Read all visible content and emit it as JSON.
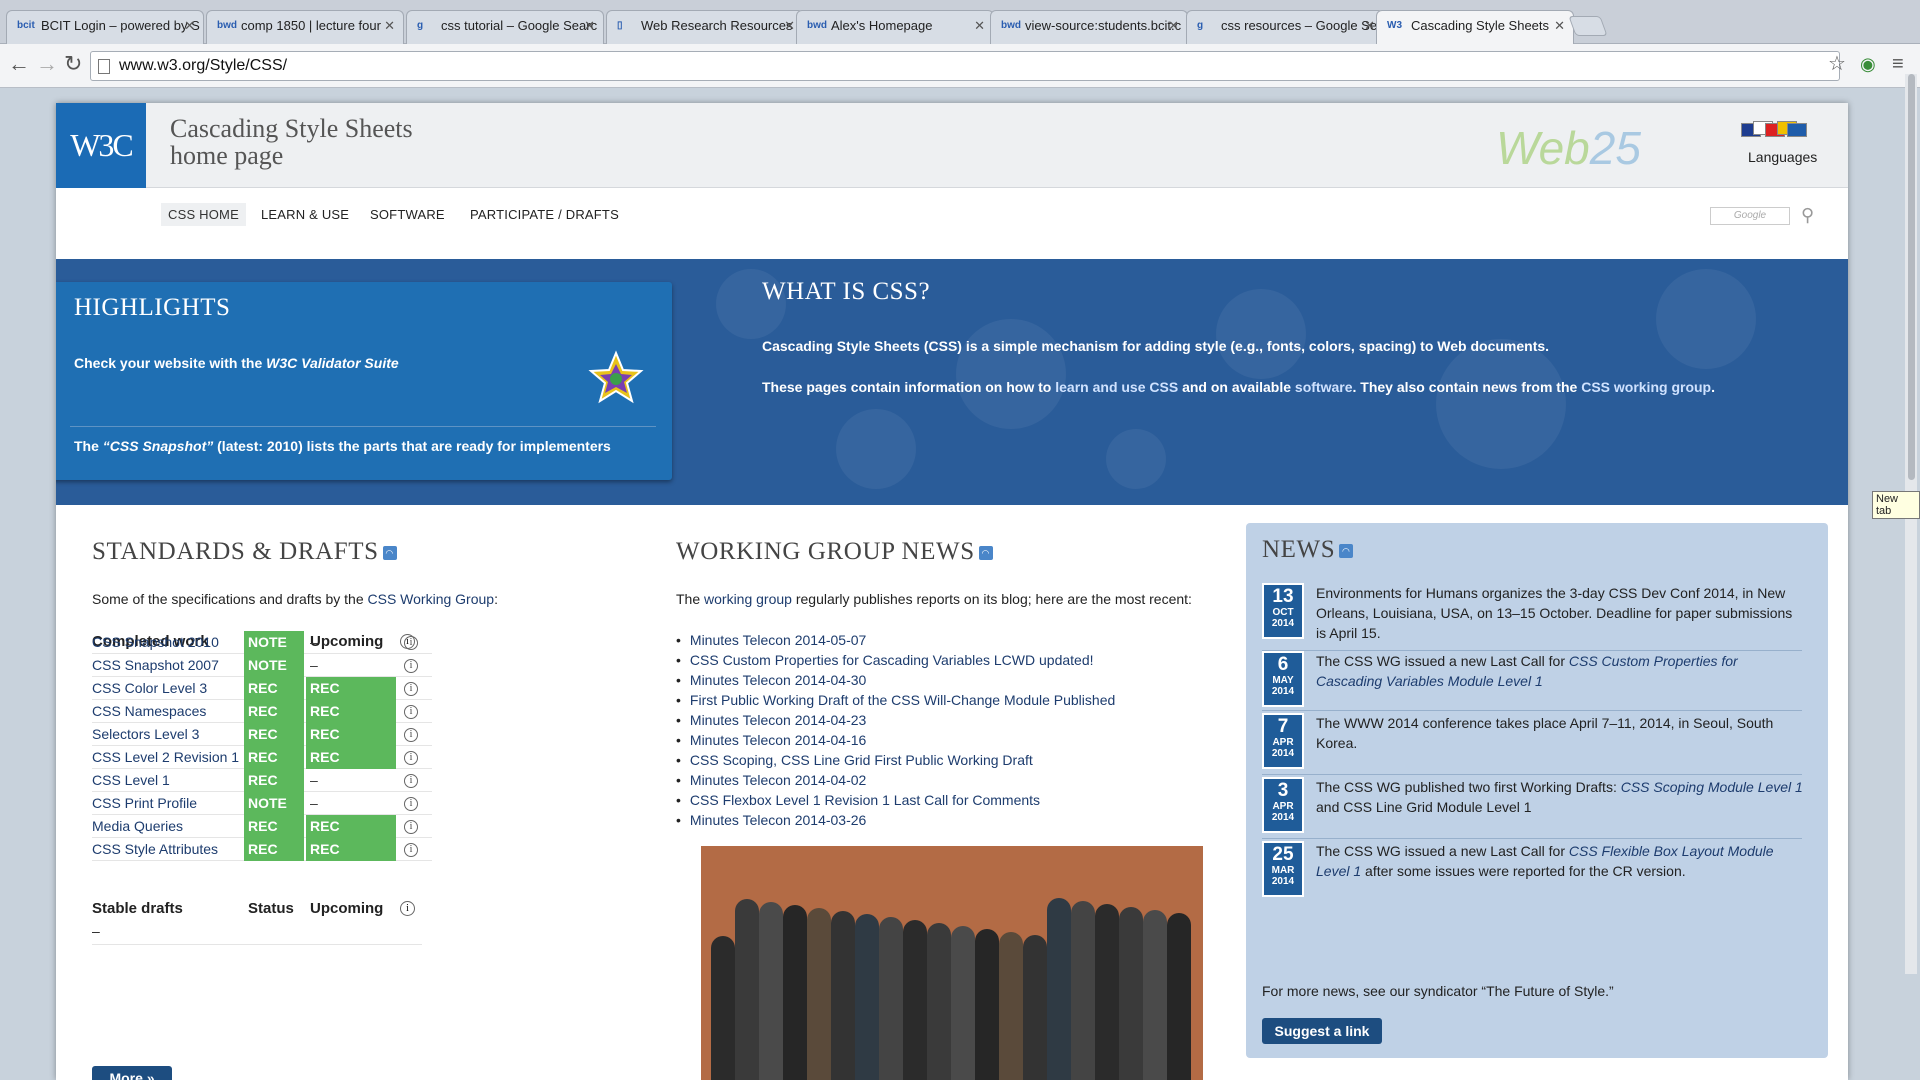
{
  "browser": {
    "tabs": [
      {
        "label": "BCIT Login – powered by S",
        "icon": "bcit"
      },
      {
        "label": "comp 1850 | lecture four",
        "icon": "bwd"
      },
      {
        "label": "css tutorial – Google Searc",
        "icon": "g"
      },
      {
        "label": "Web Research Resources",
        "icon": "page"
      },
      {
        "label": "Alex's Homepage",
        "icon": "bwd"
      },
      {
        "label": "view-source:students.bcit.c",
        "icon": "bwd"
      },
      {
        "label": "css resources – Google Sea",
        "icon": "g"
      },
      {
        "label": "Cascading Style Sheets",
        "icon": "w3c"
      }
    ],
    "url": "www.w3.org/Style/CSS/",
    "tooltip": "New tab"
  },
  "header": {
    "logo": "W3C",
    "title_line1": "Cascading Style Sheets",
    "title_line2": "home page",
    "web25": "Web",
    "web25b": "25",
    "languages": "Languages"
  },
  "menu": [
    "CSS HOME",
    "LEARN & USE",
    "SOFTWARE",
    "PARTICIPATE / DRAFTS"
  ],
  "search": {
    "placeholder": "Google"
  },
  "highlights": {
    "title": "HIGHLIGHTS",
    "line1": "Check your website with the",
    "line1_link": "W3C Validator Suite",
    "line2_pre": "The",
    "line2_link": "“CSS Snapshot”",
    "line2_post": "(latest: 2010) lists the parts that are ready for implementers"
  },
  "what": {
    "title": "WHAT IS CSS?",
    "p1": "Cascading Style Sheets (CSS) is a simple mechanism for adding style (e.g., fonts, colors, spacing) to Web documents.",
    "p2_a": "These pages contain information on how to",
    "p2_l1": "learn and use CSS",
    "p2_b": "and on available",
    "p2_l2": "software",
    "p2_c": ". They also contain news from the",
    "p2_l3": "CSS working group",
    "p2_d": "."
  },
  "standards": {
    "title": "STANDARDS & DRAFTS",
    "intro": "Some of the specifications and drafts by the",
    "intro_link": "CSS Working Group",
    "intro_end": ":",
    "head_completed": "Completed work",
    "head_status": "Status",
    "head_upcoming": "Upcoming",
    "rows": [
      {
        "name": "CSS Snapshot 2010",
        "status": "NOTE",
        "up": "–"
      },
      {
        "name": "CSS Snapshot 2007",
        "status": "NOTE",
        "up": "–"
      },
      {
        "name": "CSS Color Level 3",
        "status": "REC",
        "up": "REC"
      },
      {
        "name": "CSS Namespaces",
        "status": "REC",
        "up": "REC"
      },
      {
        "name": "Selectors Level 3",
        "status": "REC",
        "up": "REC"
      },
      {
        "name": "CSS Level 2 Revision 1",
        "status": "REC",
        "up": "REC"
      },
      {
        "name": "CSS Level 1",
        "status": "REC",
        "up": "–"
      },
      {
        "name": "CSS Print Profile",
        "status": "NOTE",
        "up": "–"
      },
      {
        "name": "Media Queries",
        "status": "REC",
        "up": "REC"
      },
      {
        "name": "CSS Style Attributes",
        "status": "REC",
        "up": "REC"
      }
    ],
    "head_stable": "Stable drafts",
    "stable_dash": "–",
    "more": "More »"
  },
  "wg": {
    "title": "WORKING GROUP NEWS",
    "intro_a": "The",
    "intro_link": "working group",
    "intro_b": "regularly publishes reports on its blog; here are the most recent:",
    "items": [
      "Minutes Telecon 2014-05-07",
      "CSS Custom Properties for Cascading Variables LCWD updated!",
      "Minutes Telecon 2014-04-30",
      "First Public Working Draft of the CSS Will-Change Module Published",
      "Minutes Telecon 2014-04-23",
      "Minutes Telecon 2014-04-16",
      "CSS Scoping, CSS Line Grid First Public Working Draft",
      "Minutes Telecon 2014-04-02",
      "CSS Flexbox Level 1 Revision 1 Last Call for Comments",
      "Minutes Telecon 2014-03-26"
    ]
  },
  "news": {
    "title": "NEWS",
    "items": [
      {
        "d": "13",
        "m": "OCT",
        "y": "2014",
        "pre": "Environments for Humans organizes the 3-day CSS Dev Conf 2014, in New Orleans, Louisiana, USA, on 13–15 October. Deadline for paper submissions is April 15.",
        "em": "",
        "post": ""
      },
      {
        "d": "6",
        "m": "MAY",
        "y": "2014",
        "pre": "The CSS WG issued a new Last Call for ",
        "em": "CSS Custom Properties for Cascading Variables Module Level 1",
        "post": ""
      },
      {
        "d": "7",
        "m": "APR",
        "y": "2014",
        "pre": "The WWW 2014 conference takes place April 7–11, 2014, in Seoul, South Korea.",
        "em": "",
        "post": ""
      },
      {
        "d": "3",
        "m": "APR",
        "y": "2014",
        "pre": "The CSS WG published two first Working Drafts: ",
        "em": "CSS Scoping Module Level 1",
        "post": " and CSS Line Grid Module Level 1"
      },
      {
        "d": "25",
        "m": "MAR",
        "y": "2014",
        "pre": "The CSS WG issued a new Last Call for ",
        "em": "CSS Flexible Box Layout Module Level 1",
        "post": " after some issues were reported for the CR version."
      }
    ],
    "footer": "For more news, see our syndicator “The Future of Style.”",
    "suggest": "Suggest a link"
  },
  "colors": {
    "banner": "#2a5c99",
    "highlight": "#1f6fb3",
    "rec": "#5cb85c",
    "news_bg": "#bfd1e6"
  }
}
